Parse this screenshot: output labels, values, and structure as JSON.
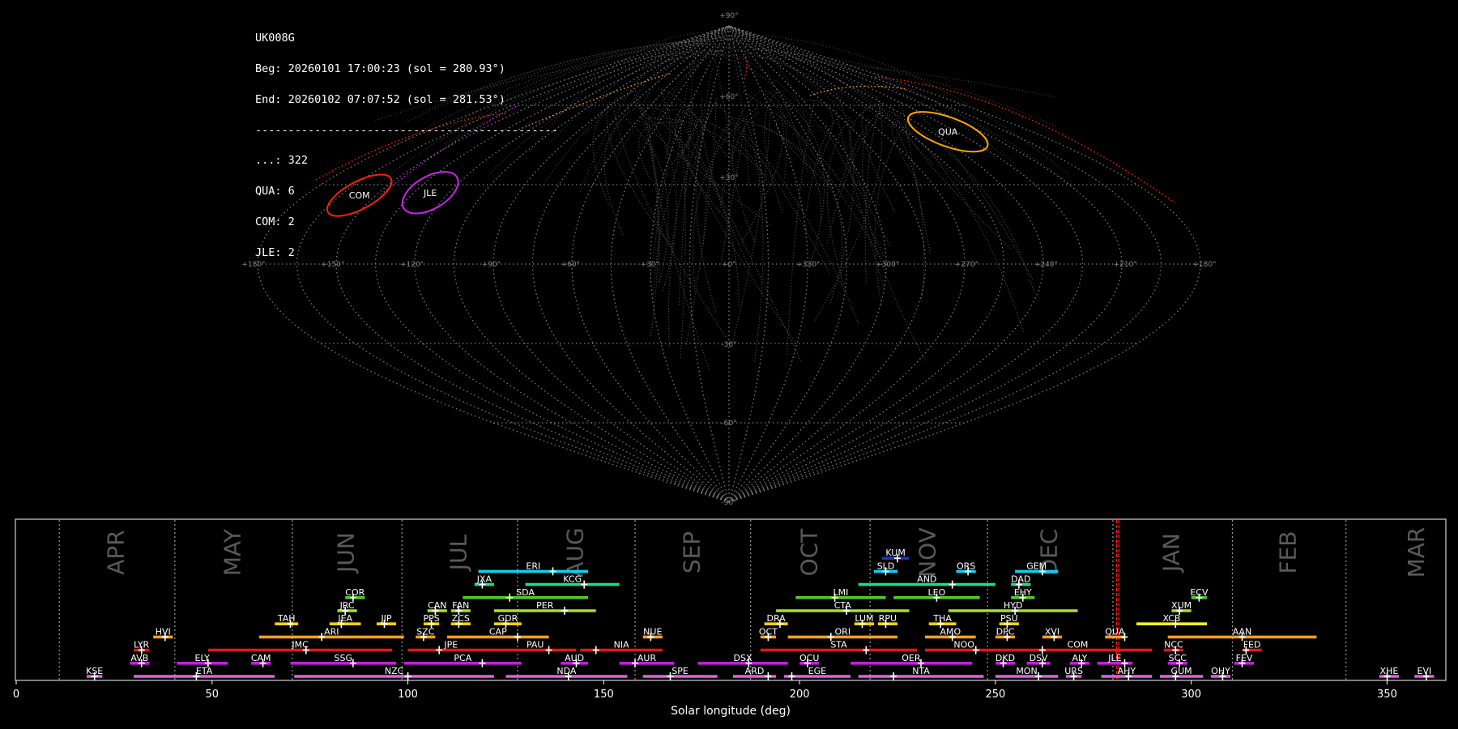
{
  "info": {
    "station": "UK008G",
    "begin": "Beg: 20260101 17:00:23 (sol = 280.93°)",
    "end": "End: 20260102 07:07:52 (sol = 281.53°)",
    "divider": "----------------------------------------------",
    "counts": [
      "...: 322",
      "QUA: 6",
      "COM: 2",
      "JLE: 2"
    ]
  },
  "chart_data": [
    {
      "type": "scatter",
      "title": "",
      "projection": "sinusoidal",
      "lon_labels": [
        "+180°",
        "+150°",
        "+120°",
        "+90°",
        "+60°",
        "+30°",
        "+0°",
        "+330°",
        "+300°",
        "+270°",
        "+240°",
        "+210°",
        "+180°"
      ],
      "lat_labels": [
        "+90°",
        "+60°",
        "+30°",
        "-30°",
        "-60°",
        "-90°"
      ],
      "grid": true,
      "radiants": [
        {
          "code": "COM",
          "lon": 157,
          "lat": 26,
          "color": "#ff2200"
        },
        {
          "code": "JLE",
          "lon": 128,
          "lat": 27,
          "color": "#cc22ee"
        },
        {
          "code": "QUA",
          "lon": 230,
          "lat": 50,
          "color": "#ffa500"
        }
      ],
      "sporadic_count": 322
    },
    {
      "type": "timeline",
      "xlabel": "Solar longitude (deg)",
      "xlim": [
        0,
        365
      ],
      "xticks": [
        0,
        50,
        100,
        150,
        200,
        250,
        300,
        350
      ],
      "months": [
        "APR",
        "MAY",
        "JUN",
        "JUL",
        "AUG",
        "SEP",
        "OCT",
        "NOV",
        "DEC",
        "JAN",
        "FEB",
        "MAR"
      ],
      "month_starts": [
        11,
        40.5,
        70.5,
        98.5,
        128,
        158,
        187.5,
        218,
        248,
        280,
        310.5,
        339.5
      ],
      "current_sol": [
        280.93,
        281.53
      ],
      "showers": [
        {
          "code": "KUM",
          "start": 221,
          "end": 228,
          "peak": 225,
          "row": 10,
          "color": "#1d35c8"
        },
        {
          "code": "ERI",
          "start": 118,
          "end": 146,
          "peak": 137,
          "row": 9,
          "color": "#10d0f0"
        },
        {
          "code": "SLD",
          "start": 219,
          "end": 225,
          "peak": 222,
          "row": 9,
          "color": "#10d0f0"
        },
        {
          "code": "ORS",
          "start": 240,
          "end": 245,
          "peak": 243,
          "row": 9,
          "color": "#10d0f0"
        },
        {
          "code": "GEM",
          "start": 255,
          "end": 266,
          "peak": 262,
          "row": 9,
          "color": "#10d0f0"
        },
        {
          "code": "JXA",
          "start": 117,
          "end": 122,
          "peak": 119,
          "row": 8,
          "color": "#18e080"
        },
        {
          "code": "KCG",
          "start": 130,
          "end": 154,
          "peak": 145,
          "row": 8,
          "color": "#18e080"
        },
        {
          "code": "AND",
          "start": 215,
          "end": 250,
          "peak": 239,
          "row": 8,
          "color": "#18e080"
        },
        {
          "code": "DAD",
          "start": 254,
          "end": 259,
          "peak": 256,
          "row": 8,
          "color": "#18e080"
        },
        {
          "code": "COR",
          "start": 84,
          "end": 89,
          "peak": 86,
          "row": 7,
          "color": "#50c828"
        },
        {
          "code": "SDA",
          "start": 114,
          "end": 146,
          "peak": 126,
          "row": 7,
          "color": "#50c828"
        },
        {
          "code": "LMI",
          "start": 199,
          "end": 222,
          "peak": 209,
          "row": 7,
          "color": "#50c828"
        },
        {
          "code": "LEO",
          "start": 224,
          "end": 246,
          "peak": 235,
          "row": 7,
          "color": "#50c828"
        },
        {
          "code": "EHY",
          "start": 254,
          "end": 260,
          "peak": 257,
          "row": 7,
          "color": "#50c828"
        },
        {
          "code": "ECV",
          "start": 300,
          "end": 304,
          "peak": 302,
          "row": 7,
          "color": "#50c828"
        },
        {
          "code": "JRC",
          "start": 82,
          "end": 87,
          "peak": 84,
          "row": 6,
          "color": "#a8e020"
        },
        {
          "code": "CAN",
          "start": 105,
          "end": 110,
          "peak": 107,
          "row": 6,
          "color": "#a8e020"
        },
        {
          "code": "FAN",
          "start": 111,
          "end": 116,
          "peak": 113,
          "row": 6,
          "color": "#a8e020"
        },
        {
          "code": "PER",
          "start": 122,
          "end": 148,
          "peak": 140,
          "row": 6,
          "color": "#a8e020"
        },
        {
          "code": "CTA",
          "start": 194,
          "end": 228,
          "peak": 212,
          "row": 6,
          "color": "#a8e020"
        },
        {
          "code": "HYD",
          "start": 238,
          "end": 271,
          "peak": 255,
          "row": 6,
          "color": "#a8e020"
        },
        {
          "code": "XUM",
          "start": 295,
          "end": 300,
          "peak": 297,
          "row": 6,
          "color": "#a8e020"
        },
        {
          "code": "TAH",
          "start": 66,
          "end": 72,
          "peak": 70,
          "row": 5,
          "color": "#f0d010"
        },
        {
          "code": "JEA",
          "start": 80,
          "end": 88,
          "peak": 83,
          "row": 5,
          "color": "#f0d010"
        },
        {
          "code": "JIP",
          "start": 92,
          "end": 97,
          "peak": 94,
          "row": 5,
          "color": "#f0d010"
        },
        {
          "code": "PPS",
          "start": 104,
          "end": 108,
          "peak": 106,
          "row": 5,
          "color": "#f0d010"
        },
        {
          "code": "ZCS",
          "start": 111,
          "end": 116,
          "peak": 113,
          "row": 5,
          "color": "#f0d010"
        },
        {
          "code": "GDR",
          "start": 122,
          "end": 129,
          "peak": 125,
          "row": 5,
          "color": "#f0d010"
        },
        {
          "code": "DRA",
          "start": 191,
          "end": 197,
          "peak": 195,
          "row": 5,
          "color": "#f0d010"
        },
        {
          "code": "LUM",
          "start": 214,
          "end": 219,
          "peak": 216,
          "row": 5,
          "color": "#f0d010"
        },
        {
          "code": "RPU",
          "start": 220,
          "end": 225,
          "peak": 222,
          "row": 5,
          "color": "#f0d010"
        },
        {
          "code": "THA",
          "start": 233,
          "end": 240,
          "peak": 236,
          "row": 5,
          "color": "#f0d010"
        },
        {
          "code": "PSU",
          "start": 251,
          "end": 256,
          "peak": 253,
          "row": 5,
          "color": "#f0d010"
        },
        {
          "code": "XCB",
          "start": 286,
          "end": 304,
          "peak": 296,
          "row": 5,
          "color": "#f0f020"
        },
        {
          "code": "HVI",
          "start": 35,
          "end": 40,
          "peak": 38,
          "row": 4,
          "color": "#f5a01a"
        },
        {
          "code": "ARI",
          "start": 62,
          "end": 99,
          "peak": 78,
          "row": 4,
          "color": "#f5a01a"
        },
        {
          "code": "SZC",
          "start": 102,
          "end": 107,
          "peak": 104,
          "row": 4,
          "color": "#f5a01a"
        },
        {
          "code": "CAP",
          "start": 110,
          "end": 136,
          "peak": 128,
          "row": 4,
          "color": "#f5a01a"
        },
        {
          "code": "NUE",
          "start": 160,
          "end": 165,
          "peak": 162,
          "row": 4,
          "color": "#f5a01a"
        },
        {
          "code": "OCT",
          "start": 190,
          "end": 194,
          "peak": 192,
          "row": 4,
          "color": "#f5a01a"
        },
        {
          "code": "ORI",
          "start": 197,
          "end": 225,
          "peak": 208,
          "row": 4,
          "color": "#f5a01a"
        },
        {
          "code": "AMO",
          "start": 232,
          "end": 245,
          "peak": 239,
          "row": 4,
          "color": "#f5a01a"
        },
        {
          "code": "DPC",
          "start": 250,
          "end": 255,
          "peak": 253,
          "row": 4,
          "color": "#f5a01a"
        },
        {
          "code": "XVI",
          "start": 262,
          "end": 267,
          "peak": 265,
          "row": 4,
          "color": "#f5a01a"
        },
        {
          "code": "QUA",
          "start": 278,
          "end": 283,
          "peak": 283,
          "row": 4,
          "color": "#f5a01a"
        },
        {
          "code": "AAN",
          "start": 294,
          "end": 332,
          "peak": 313,
          "row": 4,
          "color": "#f5a01a"
        },
        {
          "code": "LYR",
          "start": 30,
          "end": 34,
          "peak": 32,
          "row": 3,
          "color": "#e01818"
        },
        {
          "code": "JMC",
          "start": 49,
          "end": 96,
          "peak": 74,
          "row": 3,
          "color": "#e01818"
        },
        {
          "code": "JPE",
          "start": 100,
          "end": 122,
          "peak": 108,
          "row": 3,
          "color": "#e01818"
        },
        {
          "code": "PAU",
          "start": 122,
          "end": 143,
          "peak": 136,
          "row": 3,
          "color": "#e01818"
        },
        {
          "code": "NIA",
          "start": 144,
          "end": 165,
          "peak": 148,
          "row": 3,
          "color": "#e01818"
        },
        {
          "code": "STA",
          "start": 190,
          "end": 230,
          "peak": 217,
          "row": 3,
          "color": "#e01818"
        },
        {
          "code": "NOO",
          "start": 232,
          "end": 252,
          "peak": 245,
          "row": 3,
          "color": "#e01818"
        },
        {
          "code": "COM",
          "start": 252,
          "end": 290,
          "peak": 262,
          "row": 3,
          "color": "#e01818"
        },
        {
          "code": "NCC",
          "start": 293,
          "end": 298,
          "peak": 296,
          "row": 3,
          "color": "#e01818"
        },
        {
          "code": "FED",
          "start": 313,
          "end": 318,
          "peak": 314,
          "row": 3,
          "color": "#e01818"
        },
        {
          "code": "AVB",
          "start": 29,
          "end": 34,
          "peak": 32,
          "row": 2,
          "color": "#c020d8"
        },
        {
          "code": "ELY",
          "start": 41,
          "end": 54,
          "peak": 49,
          "row": 2,
          "color": "#c020d8"
        },
        {
          "code": "CAM",
          "start": 60,
          "end": 65,
          "peak": 63,
          "row": 2,
          "color": "#c020d8"
        },
        {
          "code": "SSG",
          "start": 70,
          "end": 97,
          "peak": 86,
          "row": 2,
          "color": "#c020d8"
        },
        {
          "code": "PCA",
          "start": 99,
          "end": 129,
          "peak": 119,
          "row": 2,
          "color": "#c020d8"
        },
        {
          "code": "AUD",
          "start": 139,
          "end": 146,
          "peak": 143,
          "row": 2,
          "color": "#c020d8"
        },
        {
          "code": "AUR",
          "start": 154,
          "end": 168,
          "peak": 158,
          "row": 2,
          "color": "#c020d8"
        },
        {
          "code": "DSX",
          "start": 174,
          "end": 197,
          "peak": 187,
          "row": 2,
          "color": "#c020d8"
        },
        {
          "code": "OCU",
          "start": 200,
          "end": 205,
          "peak": 202,
          "row": 2,
          "color": "#c020d8"
        },
        {
          "code": "OER",
          "start": 213,
          "end": 244,
          "peak": 231,
          "row": 2,
          "color": "#c020d8"
        },
        {
          "code": "DKD",
          "start": 250,
          "end": 255,
          "peak": 252,
          "row": 2,
          "color": "#c020d8"
        },
        {
          "code": "DSV",
          "start": 258,
          "end": 264,
          "peak": 262,
          "row": 2,
          "color": "#c020d8"
        },
        {
          "code": "ALY",
          "start": 269,
          "end": 274,
          "peak": 272,
          "row": 2,
          "color": "#c020d8"
        },
        {
          "code": "JLE",
          "start": 276,
          "end": 285,
          "peak": 283,
          "row": 2,
          "color": "#c020d8"
        },
        {
          "code": "SCC",
          "start": 294,
          "end": 299,
          "peak": 297,
          "row": 2,
          "color": "#c020d8"
        },
        {
          "code": "FEV",
          "start": 311,
          "end": 316,
          "peak": 313,
          "row": 2,
          "color": "#c020d8"
        },
        {
          "code": "KSE",
          "start": 18,
          "end": 22,
          "peak": 20,
          "row": 1,
          "color": "#e060e0"
        },
        {
          "code": "ETA",
          "start": 30,
          "end": 66,
          "peak": 46,
          "row": 1,
          "color": "#e060e0"
        },
        {
          "code": "NZC",
          "start": 71,
          "end": 122,
          "peak": 100,
          "row": 1,
          "color": "#e060e0"
        },
        {
          "code": "NDA",
          "start": 125,
          "end": 156,
          "peak": 141,
          "row": 1,
          "color": "#e060e0"
        },
        {
          "code": "SPE",
          "start": 160,
          "end": 179,
          "peak": 167,
          "row": 1,
          "color": "#e060e0"
        },
        {
          "code": "ARD",
          "start": 183,
          "end": 194,
          "peak": 192,
          "row": 1,
          "color": "#e060e0"
        },
        {
          "code": "EGE",
          "start": 196,
          "end": 213,
          "peak": 198,
          "row": 1,
          "color": "#e060e0"
        },
        {
          "code": "NTA",
          "start": 215,
          "end": 247,
          "peak": 224,
          "row": 1,
          "color": "#e060e0"
        },
        {
          "code": "MON",
          "start": 250,
          "end": 266,
          "peak": 261,
          "row": 1,
          "color": "#e060e0"
        },
        {
          "code": "URS",
          "start": 268,
          "end": 272,
          "peak": 270,
          "row": 1,
          "color": "#e060e0"
        },
        {
          "code": "AHY",
          "start": 277,
          "end": 290,
          "peak": 284,
          "row": 1,
          "color": "#e060e0"
        },
        {
          "code": "GUM",
          "start": 292,
          "end": 303,
          "peak": 296,
          "row": 1,
          "color": "#e060e0"
        },
        {
          "code": "OHY",
          "start": 305,
          "end": 310,
          "peak": 308,
          "row": 1,
          "color": "#e060e0"
        },
        {
          "code": "XHE",
          "start": 348,
          "end": 353,
          "peak": 350,
          "row": 1,
          "color": "#e060e0"
        },
        {
          "code": "EVI",
          "start": 357,
          "end": 362,
          "peak": 360,
          "row": 1,
          "color": "#e060e0"
        }
      ]
    }
  ]
}
